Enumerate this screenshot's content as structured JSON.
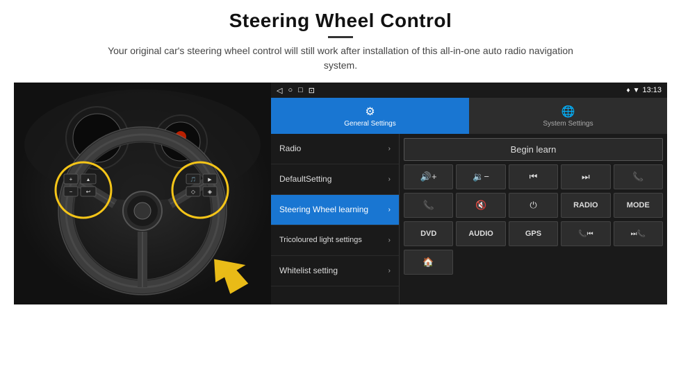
{
  "header": {
    "title": "Steering Wheel Control",
    "subtitle": "Your original car's steering wheel control will still work after installation of this all-in-one auto radio navigation system."
  },
  "status_bar": {
    "time": "13:13",
    "icons": [
      "◁",
      "○",
      "□",
      "⊡"
    ]
  },
  "tabs": [
    {
      "id": "general",
      "label": "General Settings",
      "active": true
    },
    {
      "id": "system",
      "label": "System Settings",
      "active": false
    }
  ],
  "menu_items": [
    {
      "id": "radio",
      "label": "Radio",
      "active": false
    },
    {
      "id": "default",
      "label": "DefaultSetting",
      "active": false
    },
    {
      "id": "steering",
      "label": "Steering Wheel learning",
      "active": true
    },
    {
      "id": "tricolour",
      "label": "Tricoloured light settings",
      "active": false
    },
    {
      "id": "whitelist",
      "label": "Whitelist setting",
      "active": false
    }
  ],
  "controls": {
    "begin_learn_label": "Begin learn",
    "row1": [
      {
        "icon": "🔊+",
        "type": "icon"
      },
      {
        "icon": "🔉-",
        "type": "icon"
      },
      {
        "icon": "⏮",
        "type": "icon"
      },
      {
        "icon": "⏭",
        "type": "icon"
      },
      {
        "icon": "📞",
        "type": "icon"
      }
    ],
    "row2": [
      {
        "icon": "📞↩",
        "type": "icon"
      },
      {
        "icon": "🔇",
        "type": "icon"
      },
      {
        "icon": "⏻",
        "type": "icon"
      },
      {
        "label": "RADIO",
        "type": "text"
      },
      {
        "label": "MODE",
        "type": "text"
      }
    ],
    "row3": [
      {
        "label": "DVD",
        "type": "text"
      },
      {
        "label": "AUDIO",
        "type": "text"
      },
      {
        "label": "GPS",
        "type": "text"
      },
      {
        "icon": "📞⏮",
        "type": "icon"
      },
      {
        "icon": "⏮📞",
        "type": "icon"
      }
    ],
    "row4_single": {
      "icon": "🏠",
      "type": "icon"
    }
  }
}
